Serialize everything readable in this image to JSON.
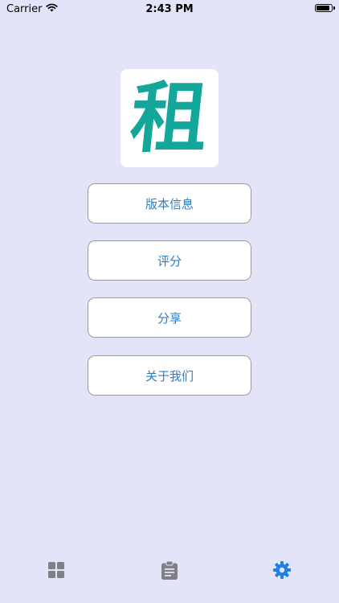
{
  "status_bar": {
    "carrier": "Carrier",
    "time": "2:43 PM"
  },
  "logo": {
    "character": "租"
  },
  "menu": {
    "items": [
      {
        "label": "版本信息"
      },
      {
        "label": "评分"
      },
      {
        "label": "分享"
      },
      {
        "label": "关于我们"
      }
    ]
  },
  "tab_bar": {
    "tabs": [
      {
        "icon": "grid-icon",
        "selected": false
      },
      {
        "icon": "clipboard-icon",
        "selected": false
      },
      {
        "icon": "gear-icon",
        "selected": true
      }
    ]
  },
  "colors": {
    "background": "#e4e4f9",
    "accent": "#2d7cc8",
    "logo": "#12a79a",
    "tab_inactive": "#7f7f86",
    "tab_active": "#1e7fe6"
  }
}
